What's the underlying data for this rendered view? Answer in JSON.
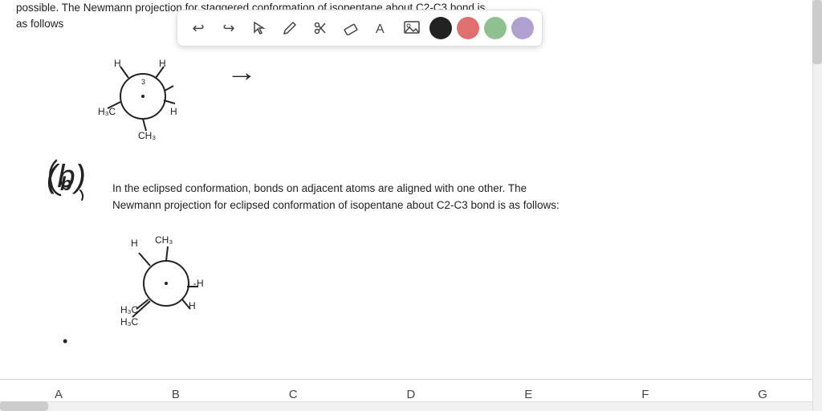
{
  "toolbar": {
    "undo_label": "↩",
    "redo_label": "↪",
    "select_label": "↖",
    "draw_label": "✏",
    "scissors_label": "✂",
    "eraser_label": "/",
    "text_label": "A",
    "image_label": "🖼",
    "colors": [
      "#222222",
      "#e07070",
      "#90c090",
      "#b0a0d0"
    ]
  },
  "text_top": "possible. The Newmann projection for staggered conformation of isopentane about C2-C3 bond is",
  "text_top2": "as follows",
  "text_b_line1": "In the eclipsed conformation, bonds on adjacent atoms are aligned with one other. The",
  "text_b_line2": "Newmann projection for eclipsed conformation of isopentane about C2-C3 bond is as follows:",
  "bottom_nav": {
    "items": [
      "A",
      "B",
      "C",
      "D",
      "E",
      "F",
      "G"
    ]
  }
}
